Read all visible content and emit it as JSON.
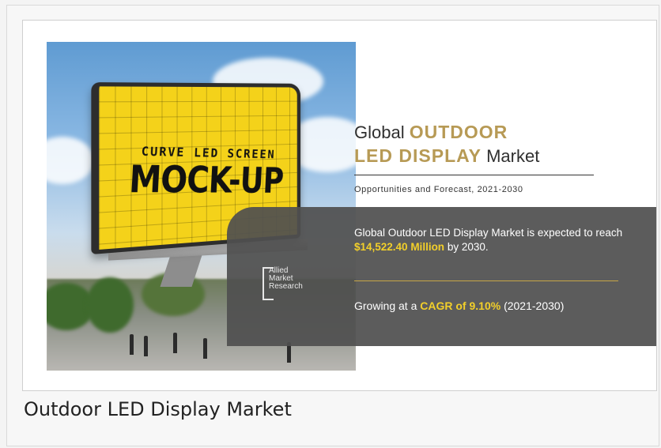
{
  "figure": {
    "photo": {
      "screen_subtitle": "CURVE LED SCREEN",
      "screen_title": "MOCK-UP"
    },
    "logo": {
      "line1": "Allied",
      "line2": "Market",
      "line3": "Research"
    },
    "title": {
      "part1": "Global ",
      "highlight1": "OUTDOOR",
      "highlight2": "LED DISPLAY",
      "part2": " Market"
    },
    "subtitle": "Opportunities and Forecast, 2021-2030",
    "stat_market": {
      "prefix": "Global Outdoor LED Display Market is expected to reach ",
      "value": "$14,522.40 Million",
      "suffix": " by 2030."
    },
    "stat_cagr": {
      "prefix": "Growing at a ",
      "value": "CAGR of 9.10%",
      "suffix": " (2021-2030)"
    },
    "colors": {
      "accent_gold": "#b79a55",
      "highlight_yellow": "#f2cf2a",
      "panel_gray": "#505050"
    }
  },
  "caption": "Outdoor LED Display Market"
}
